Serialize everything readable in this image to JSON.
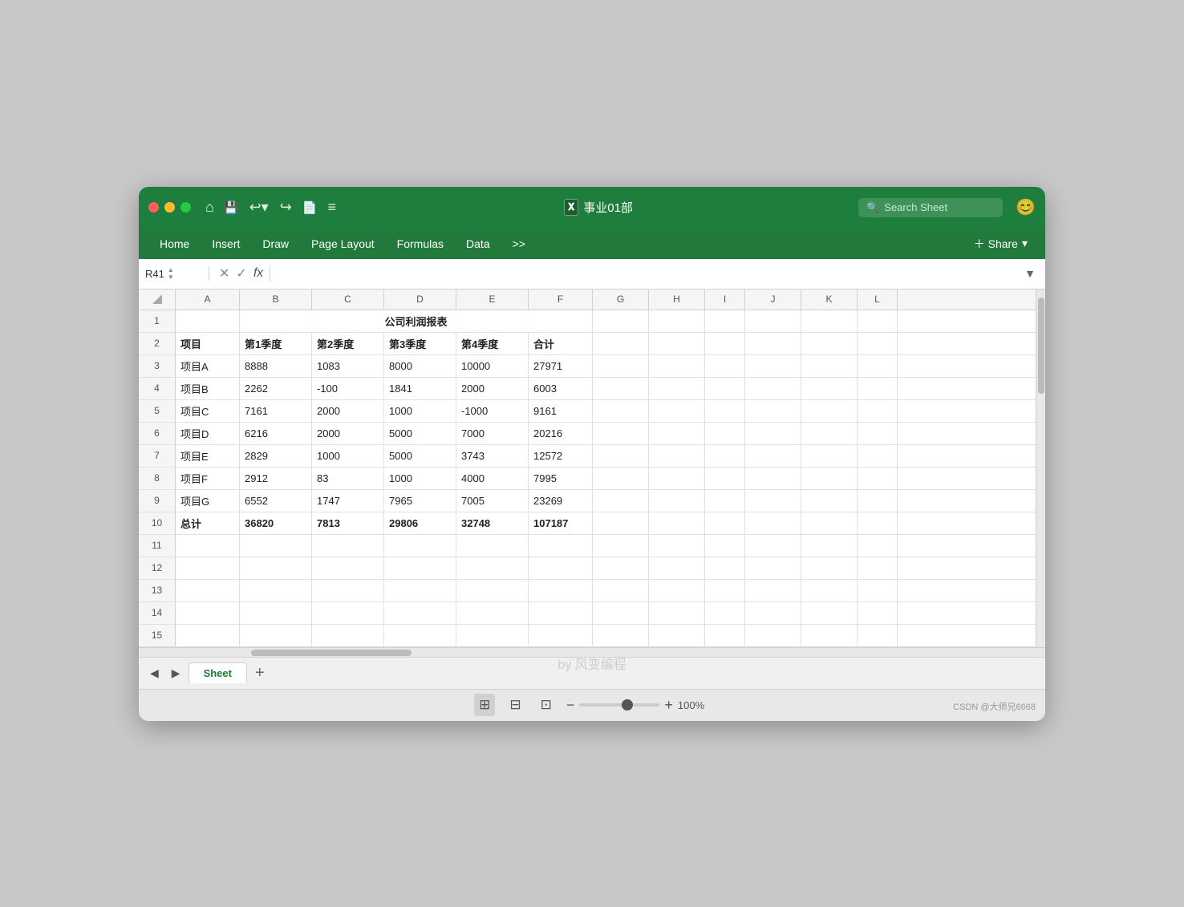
{
  "titleBar": {
    "trafficLights": [
      "red",
      "yellow",
      "green"
    ],
    "homeIcon": "⌂",
    "saveIcon": "💾",
    "undoIcon": "↩",
    "undoArrow": "▾",
    "redoIcon": "↪",
    "fileIcon": "📄",
    "moreIcon": "≡",
    "appTitle": "事业01部",
    "searchPlaceholder": "Search Sheet",
    "smileyIcon": "😊"
  },
  "menuBar": {
    "items": [
      "Home",
      "Insert",
      "Draw",
      "Page Layout",
      "Formulas",
      "Data",
      ">>"
    ],
    "shareLabel": "＋ Share",
    "shareDropdown": "▾"
  },
  "formulaBar": {
    "cellRef": "R41",
    "cancelIcon": "✕",
    "confirmIcon": "✓",
    "fxLabel": "fx",
    "formula": ""
  },
  "columns": {
    "headers": [
      "A",
      "B",
      "C",
      "D",
      "E",
      "F",
      "G",
      "H",
      "I",
      "J",
      "K",
      "L"
    ],
    "widths": [
      80,
      90,
      90,
      90,
      90,
      80,
      70,
      70,
      50,
      70,
      70,
      50
    ]
  },
  "rows": [
    {
      "num": 1,
      "cells": [
        {
          "span": 6,
          "value": "公司利润报表",
          "bold": true,
          "center": true
        },
        {
          "value": ""
        },
        {
          "value": ""
        },
        {
          "value": ""
        },
        {
          "value": ""
        },
        {
          "value": ""
        },
        {
          "value": ""
        },
        {
          "value": ""
        },
        {
          "value": ""
        },
        {
          "value": ""
        },
        {
          "value": ""
        }
      ]
    },
    {
      "num": 2,
      "cells": [
        {
          "value": "项目"
        },
        {
          "value": "第1季度"
        },
        {
          "value": "第2季度"
        },
        {
          "value": "第3季度"
        },
        {
          "value": "第4季度"
        },
        {
          "value": "合计"
        },
        {
          "value": ""
        },
        {
          "value": ""
        },
        {
          "value": ""
        },
        {
          "value": ""
        },
        {
          "value": ""
        },
        {
          "value": ""
        }
      ]
    },
    {
      "num": 3,
      "cells": [
        {
          "value": "项目A"
        },
        {
          "value": "8888"
        },
        {
          "value": "1083"
        },
        {
          "value": "8000"
        },
        {
          "value": "10000"
        },
        {
          "value": "27971"
        },
        {
          "value": ""
        },
        {
          "value": ""
        },
        {
          "value": ""
        },
        {
          "value": ""
        },
        {
          "value": ""
        },
        {
          "value": ""
        }
      ]
    },
    {
      "num": 4,
      "cells": [
        {
          "value": "项目B"
        },
        {
          "value": "2262"
        },
        {
          "value": "-100"
        },
        {
          "value": "1841"
        },
        {
          "value": "2000"
        },
        {
          "value": "6003"
        },
        {
          "value": ""
        },
        {
          "value": ""
        },
        {
          "value": ""
        },
        {
          "value": ""
        },
        {
          "value": ""
        },
        {
          "value": ""
        }
      ]
    },
    {
      "num": 5,
      "cells": [
        {
          "value": "项目C"
        },
        {
          "value": "7161"
        },
        {
          "value": "2000"
        },
        {
          "value": "1000"
        },
        {
          "value": "-1000"
        },
        {
          "value": "9161"
        },
        {
          "value": ""
        },
        {
          "value": ""
        },
        {
          "value": ""
        },
        {
          "value": ""
        },
        {
          "value": ""
        },
        {
          "value": ""
        }
      ]
    },
    {
      "num": 6,
      "cells": [
        {
          "value": "项目D"
        },
        {
          "value": "6216"
        },
        {
          "value": "2000"
        },
        {
          "value": "5000"
        },
        {
          "value": "7000"
        },
        {
          "value": "20216"
        },
        {
          "value": ""
        },
        {
          "value": ""
        },
        {
          "value": ""
        },
        {
          "value": ""
        },
        {
          "value": ""
        },
        {
          "value": ""
        }
      ]
    },
    {
      "num": 7,
      "cells": [
        {
          "value": "项目E"
        },
        {
          "value": "2829"
        },
        {
          "value": "1000"
        },
        {
          "value": "5000"
        },
        {
          "value": "3743"
        },
        {
          "value": "12572"
        },
        {
          "value": ""
        },
        {
          "value": ""
        },
        {
          "value": ""
        },
        {
          "value": ""
        },
        {
          "value": ""
        },
        {
          "value": ""
        }
      ]
    },
    {
      "num": 8,
      "cells": [
        {
          "value": "项目F"
        },
        {
          "value": "2912"
        },
        {
          "value": "83"
        },
        {
          "value": "1000"
        },
        {
          "value": "4000"
        },
        {
          "value": "7995"
        },
        {
          "value": ""
        },
        {
          "value": ""
        },
        {
          "value": ""
        },
        {
          "value": ""
        },
        {
          "value": ""
        },
        {
          "value": ""
        }
      ]
    },
    {
      "num": 9,
      "cells": [
        {
          "value": "项目G"
        },
        {
          "value": "6552"
        },
        {
          "value": "1747"
        },
        {
          "value": "7965"
        },
        {
          "value": "7005"
        },
        {
          "value": "23269"
        },
        {
          "value": ""
        },
        {
          "value": ""
        },
        {
          "value": ""
        },
        {
          "value": ""
        },
        {
          "value": ""
        },
        {
          "value": ""
        }
      ]
    },
    {
      "num": 10,
      "cells": [
        {
          "value": "总计"
        },
        {
          "value": "36820"
        },
        {
          "value": "7813"
        },
        {
          "value": "29806"
        },
        {
          "value": "32748"
        },
        {
          "value": "107187"
        },
        {
          "value": ""
        },
        {
          "value": ""
        },
        {
          "value": ""
        },
        {
          "value": ""
        },
        {
          "value": ""
        },
        {
          "value": ""
        }
      ]
    },
    {
      "num": 11,
      "cells": [
        {
          "value": ""
        },
        {
          "value": ""
        },
        {
          "value": ""
        },
        {
          "value": ""
        },
        {
          "value": ""
        },
        {
          "value": ""
        },
        {
          "value": ""
        },
        {
          "value": ""
        },
        {
          "value": ""
        },
        {
          "value": ""
        },
        {
          "value": ""
        },
        {
          "value": ""
        }
      ]
    },
    {
      "num": 12,
      "cells": [
        {
          "value": ""
        },
        {
          "value": ""
        },
        {
          "value": ""
        },
        {
          "value": ""
        },
        {
          "value": ""
        },
        {
          "value": ""
        },
        {
          "value": ""
        },
        {
          "value": ""
        },
        {
          "value": ""
        },
        {
          "value": ""
        },
        {
          "value": ""
        },
        {
          "value": ""
        }
      ]
    },
    {
      "num": 13,
      "cells": [
        {
          "value": ""
        },
        {
          "value": ""
        },
        {
          "value": ""
        },
        {
          "value": ""
        },
        {
          "value": ""
        },
        {
          "value": ""
        },
        {
          "value": ""
        },
        {
          "value": ""
        },
        {
          "value": ""
        },
        {
          "value": ""
        },
        {
          "value": ""
        },
        {
          "value": ""
        }
      ]
    },
    {
      "num": 14,
      "cells": [
        {
          "value": ""
        },
        {
          "value": ""
        },
        {
          "value": ""
        },
        {
          "value": ""
        },
        {
          "value": ""
        },
        {
          "value": ""
        },
        {
          "value": ""
        },
        {
          "value": ""
        },
        {
          "value": ""
        },
        {
          "value": ""
        },
        {
          "value": ""
        },
        {
          "value": ""
        }
      ]
    },
    {
      "num": 15,
      "cells": [
        {
          "value": ""
        },
        {
          "value": ""
        },
        {
          "value": ""
        },
        {
          "value": ""
        },
        {
          "value": ""
        },
        {
          "value": ""
        },
        {
          "value": ""
        },
        {
          "value": ""
        },
        {
          "value": ""
        },
        {
          "value": ""
        },
        {
          "value": ""
        },
        {
          "value": ""
        }
      ]
    }
  ],
  "sheetTabs": {
    "activeTab": "Sheet",
    "addLabel": "+"
  },
  "statusBar": {
    "viewNormal": "⊞",
    "viewPage": "⊟",
    "viewBreak": "⊡",
    "zoomMinus": "−",
    "zoomPlus": "+",
    "zoomLevel": "100%",
    "zoomValue": 60
  },
  "watermark": "by 风变编程",
  "csdn": "CSDN @大师兄6668"
}
